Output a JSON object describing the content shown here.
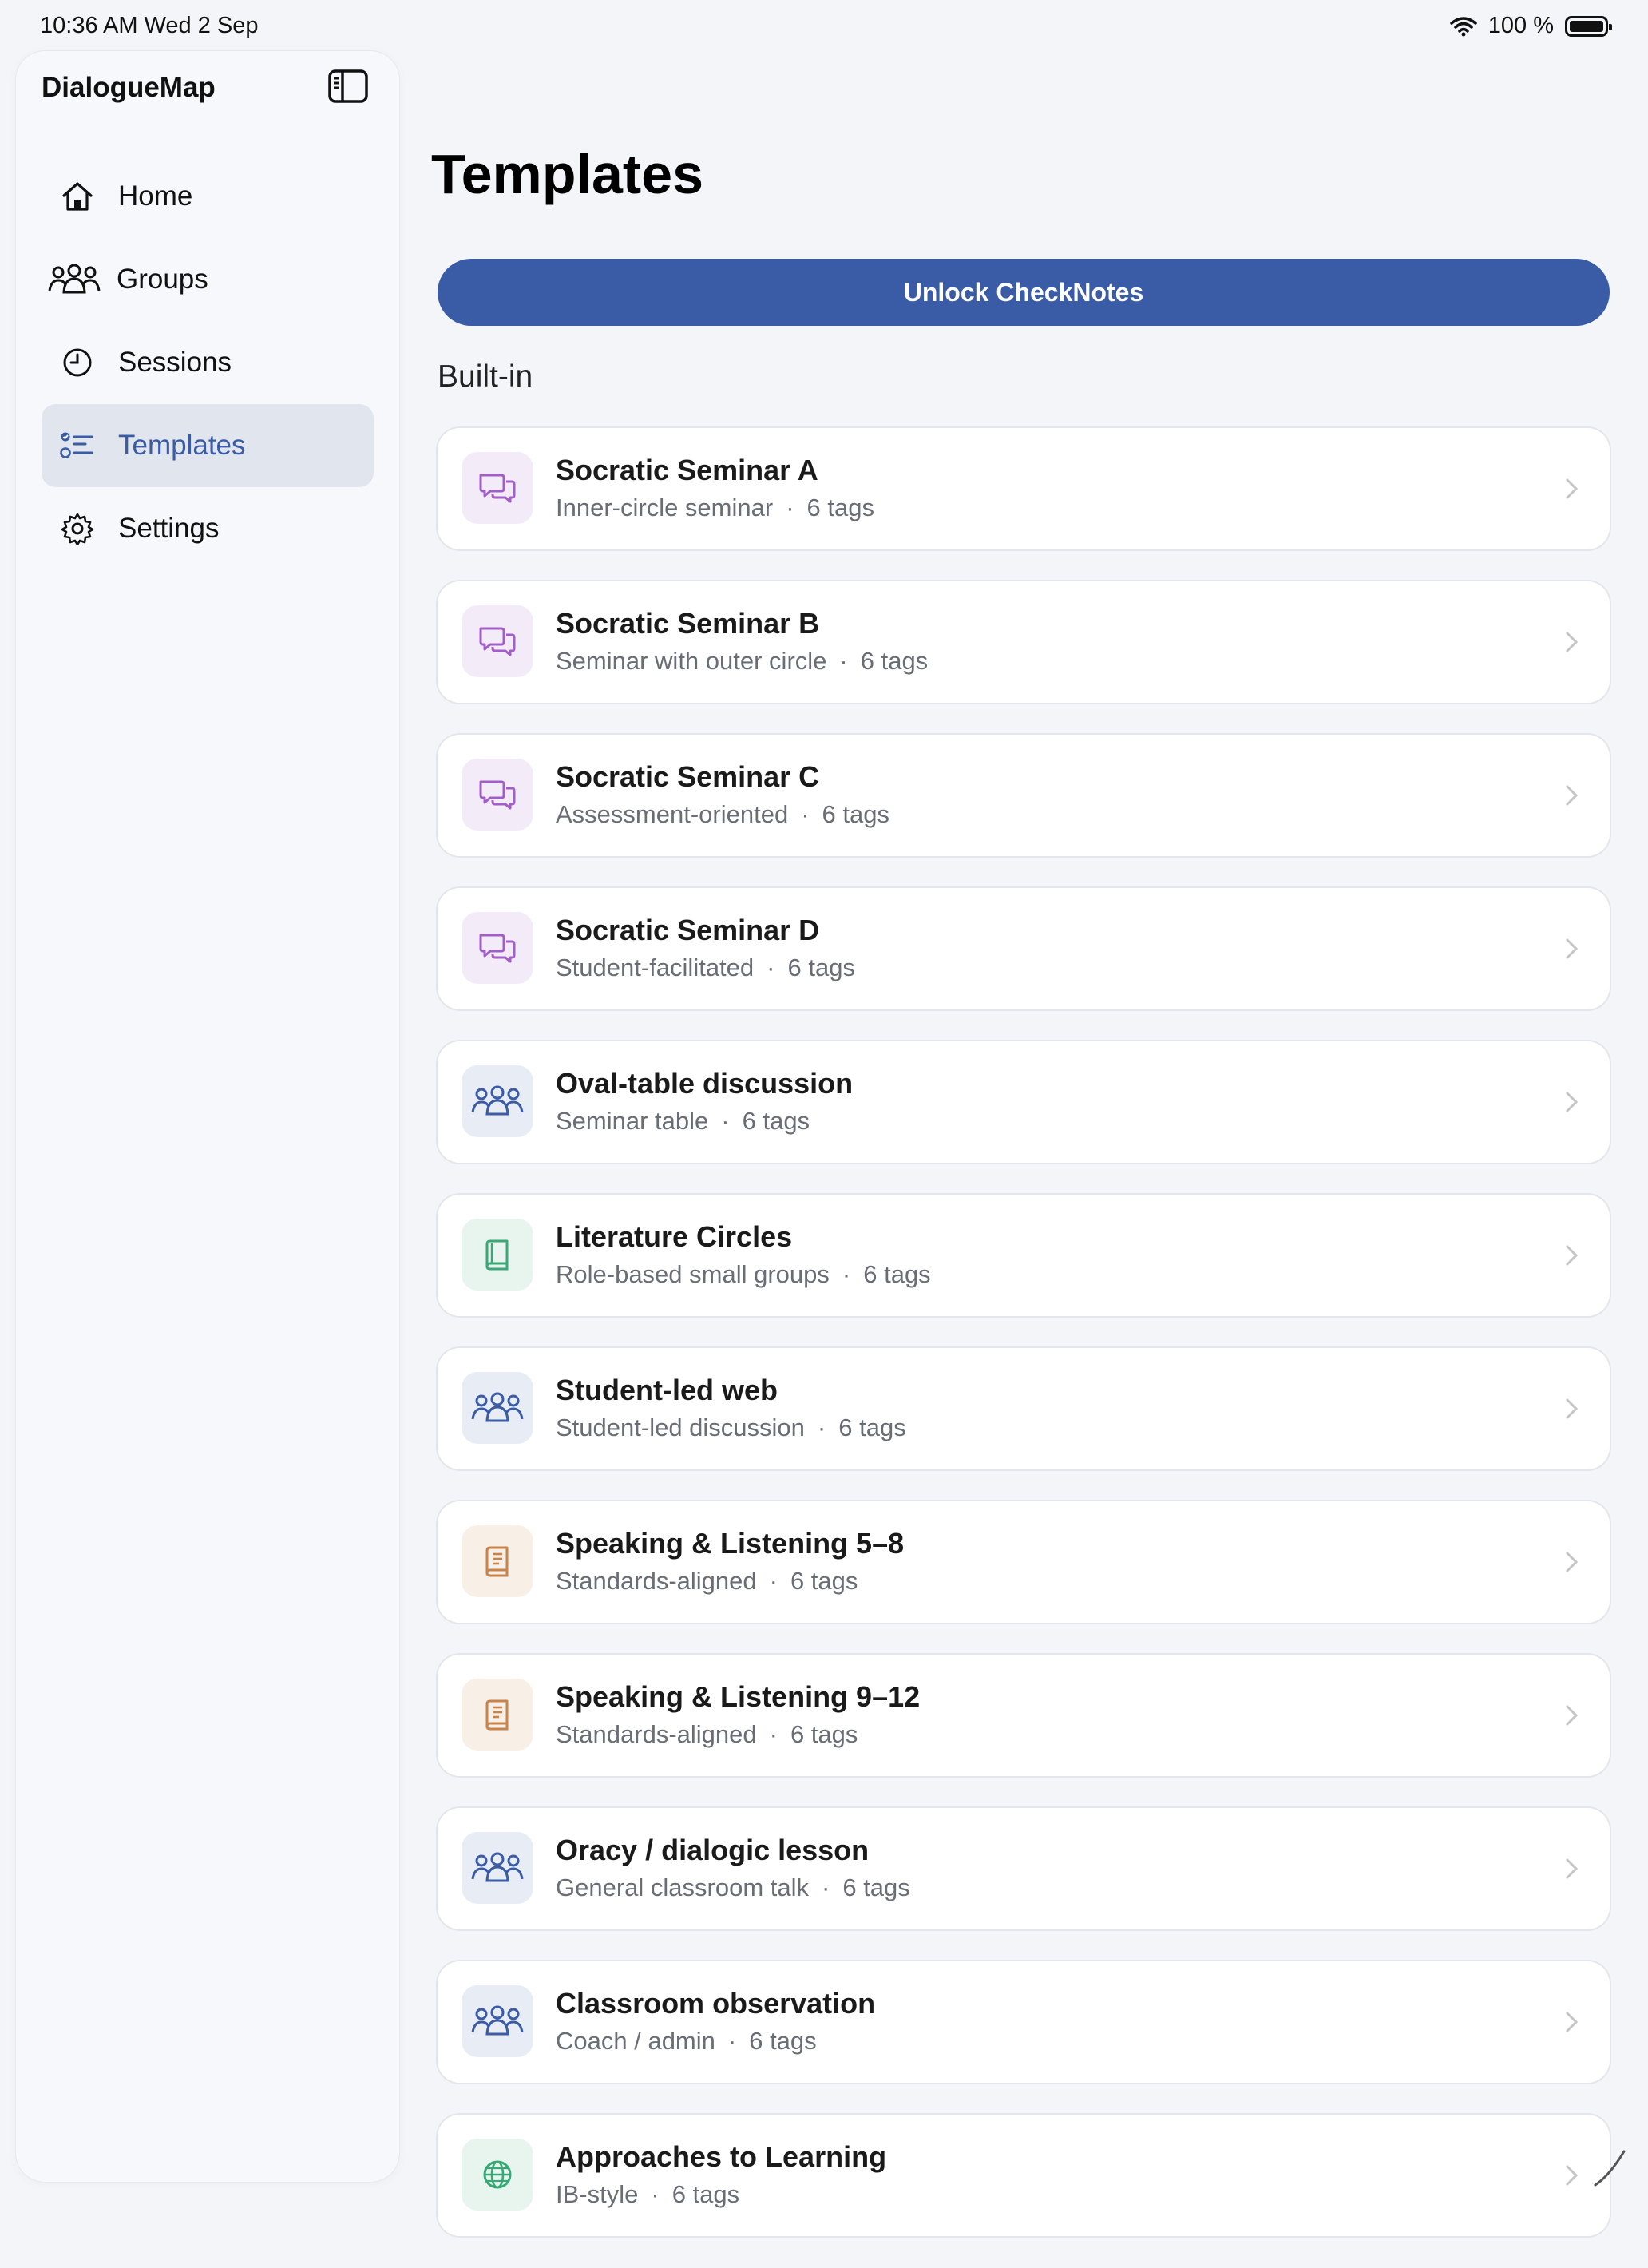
{
  "status": {
    "time": "10:36 AM   Wed 2 Sep",
    "battery": "100 %"
  },
  "sidebar": {
    "app_title": "DialogueMap",
    "items": [
      {
        "label": "Home",
        "icon": "house-icon"
      },
      {
        "label": "Groups",
        "icon": "people-icon"
      },
      {
        "label": "Sessions",
        "icon": "clock-icon"
      },
      {
        "label": "Templates",
        "icon": "checklist-icon",
        "active": true
      },
      {
        "label": "Settings",
        "icon": "gear-icon"
      }
    ]
  },
  "main": {
    "title": "Templates",
    "unlock_label": "Unlock CheckNotes",
    "section_label": "Built-in",
    "templates": [
      {
        "title": "Socratic Seminar A",
        "desc": "Inner-circle seminar",
        "tags": "6 tags",
        "icon": "chat-bubbles-icon",
        "tint": "purple"
      },
      {
        "title": "Socratic Seminar B",
        "desc": "Seminar with outer circle",
        "tags": "6 tags",
        "icon": "chat-bubbles-icon",
        "tint": "purple"
      },
      {
        "title": "Socratic Seminar C",
        "desc": "Assessment-oriented",
        "tags": "6 tags",
        "icon": "chat-bubbles-icon",
        "tint": "purple"
      },
      {
        "title": "Socratic Seminar D",
        "desc": "Student-facilitated",
        "tags": "6 tags",
        "icon": "chat-bubbles-icon",
        "tint": "purple"
      },
      {
        "title": "Oval-table discussion",
        "desc": "Seminar table",
        "tags": "6 tags",
        "icon": "people-icon",
        "tint": "blue"
      },
      {
        "title": "Literature Circles",
        "desc": "Role-based small groups",
        "tags": "6 tags",
        "icon": "book-icon",
        "tint": "green"
      },
      {
        "title": "Student-led web",
        "desc": "Student-led discussion",
        "tags": "6 tags",
        "icon": "people-icon",
        "tint": "blue"
      },
      {
        "title": "Speaking & Listening 5–8",
        "desc": "Standards-aligned",
        "tags": "6 tags",
        "icon": "document-icon",
        "tint": "orange"
      },
      {
        "title": "Speaking & Listening 9–12",
        "desc": "Standards-aligned",
        "tags": "6 tags",
        "icon": "document-icon",
        "tint": "orange"
      },
      {
        "title": "Oracy / dialogic lesson",
        "desc": "General classroom talk",
        "tags": "6 tags",
        "icon": "people-icon",
        "tint": "blue"
      },
      {
        "title": "Classroom observation",
        "desc": "Coach / admin",
        "tags": "6 tags",
        "icon": "people-icon",
        "tint": "blue"
      },
      {
        "title": "Approaches to Learning",
        "desc": "IB-style",
        "tags": "6 tags",
        "icon": "globe-icon",
        "tint": "green"
      }
    ]
  },
  "colors": {
    "accent": "#3a5ba5",
    "purple_bg": "#f3ecf8",
    "purple_fg": "#a25ec8",
    "blue_bg": "#e8ecf4",
    "blue_fg": "#3a5ba5",
    "green_bg": "#e7f5ee",
    "green_fg": "#3aa776",
    "orange_bg": "#f8efe6",
    "orange_fg": "#c8834a"
  }
}
